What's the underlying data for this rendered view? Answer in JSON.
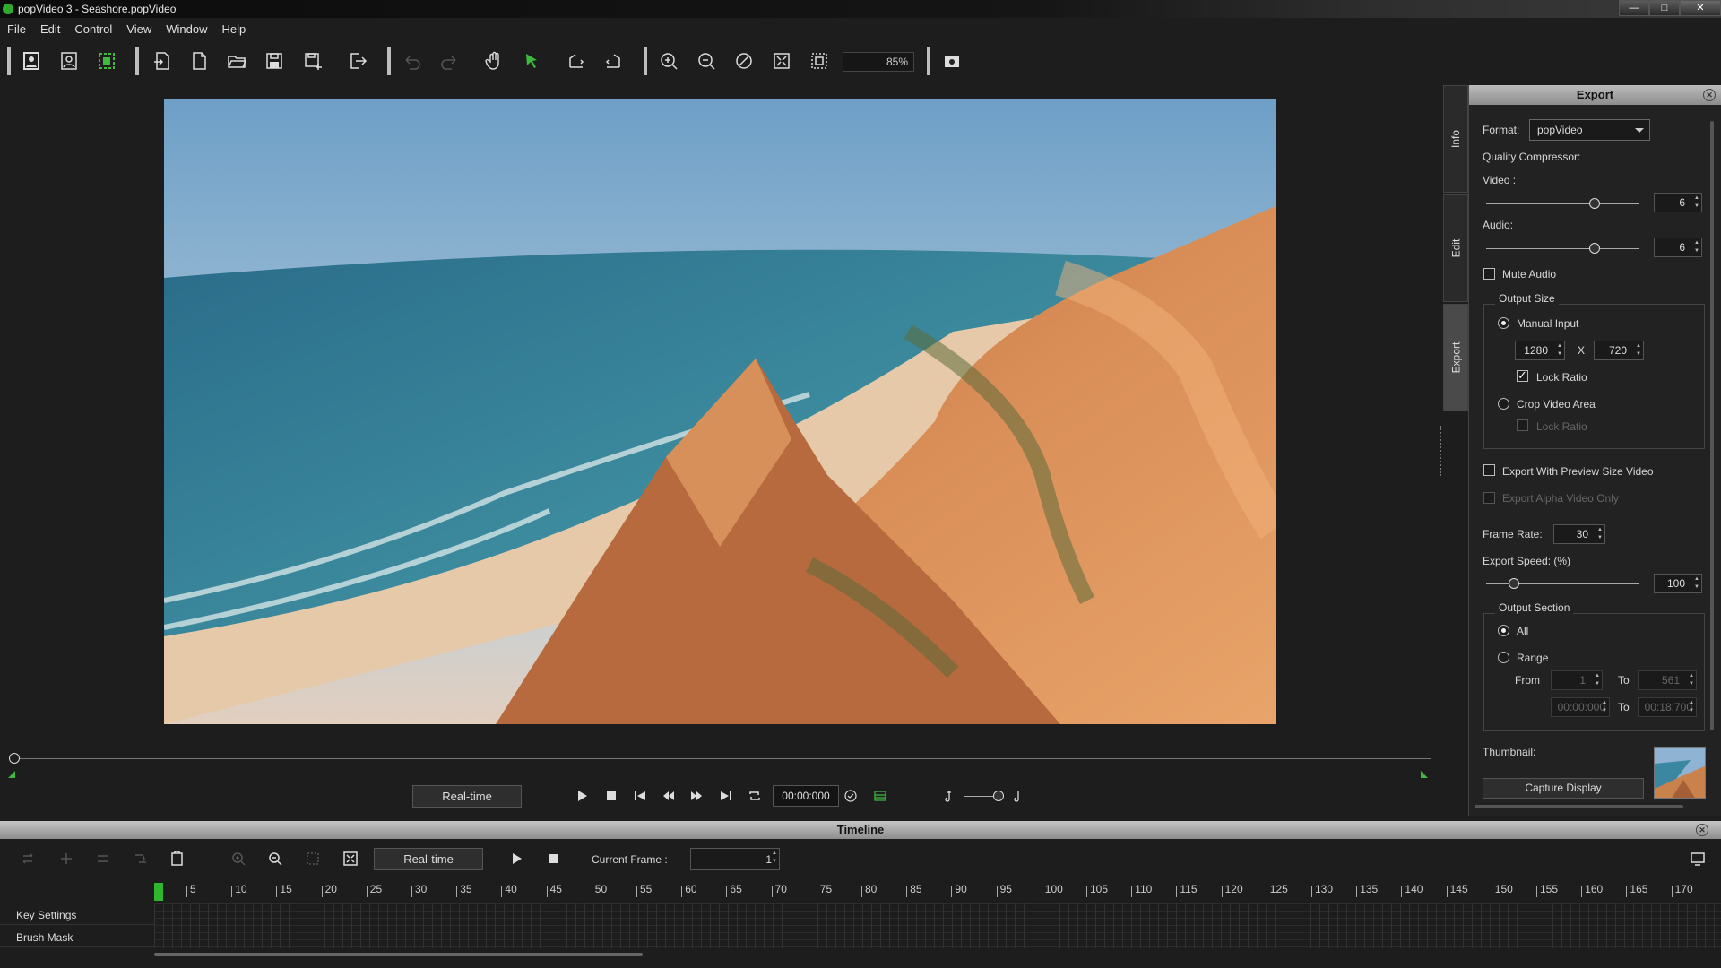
{
  "window": {
    "title": "popVideo 3 - Seashore.popVideo",
    "min": "—",
    "max": "□",
    "close": "✕"
  },
  "menu": [
    "File",
    "Edit",
    "Control",
    "View",
    "Window",
    "Help"
  ],
  "toolbar": {
    "zoom": "85%"
  },
  "playback": {
    "mode": "Real-time",
    "time": "00:00:000"
  },
  "side_tabs": [
    "Info",
    "Edit",
    "Export"
  ],
  "export": {
    "title": "Export",
    "format_label": "Format:",
    "format_value": "popVideo",
    "quality_label": "Quality Compressor:",
    "video_label": "Video :",
    "video_value": "6",
    "video_level": 0.71,
    "audio_label": "Audio:",
    "audio_value": "6",
    "audio_level": 0.71,
    "mute_label": "Mute Audio",
    "output_size_label": "Output Size",
    "manual_input_label": "Manual Input",
    "width": "1280",
    "x_label": "X",
    "height": "720",
    "lock_ratio_label": "Lock Ratio",
    "crop_label": "Crop Video Area",
    "lock_ratio2_label": "Lock Ratio",
    "preview_size_label": "Export With Preview Size Video",
    "alpha_label": "Export Alpha Video Only",
    "frame_rate_label": "Frame Rate:",
    "frame_rate": "30",
    "speed_label": "Export Speed: (%)",
    "speed": "100",
    "speed_level": 0.18,
    "output_section_label": "Output Section",
    "all_label": "All",
    "range_label": "Range",
    "from_label": "From",
    "from_value": "1",
    "to_label": "To",
    "to_value": "561",
    "from_time": "00:00:000",
    "to_label2": "To",
    "to_time": "00:18:700",
    "thumbnail_label": "Thumbnail:",
    "capture_label": "Capture Display"
  },
  "timeline": {
    "title": "Timeline",
    "mode": "Real-time",
    "current_frame_label": "Current Frame :",
    "current_frame": "1",
    "ruler": [
      "5",
      "10",
      "15",
      "20",
      "25",
      "30",
      "35",
      "40",
      "45",
      "50",
      "55",
      "60",
      "65",
      "70",
      "75",
      "80",
      "85",
      "90",
      "95",
      "100",
      "105",
      "110",
      "115",
      "120",
      "125",
      "130",
      "135",
      "140",
      "145",
      "150",
      "155",
      "160",
      "165",
      "170"
    ],
    "tracks": [
      "Key Settings",
      "Brush Mask"
    ]
  }
}
